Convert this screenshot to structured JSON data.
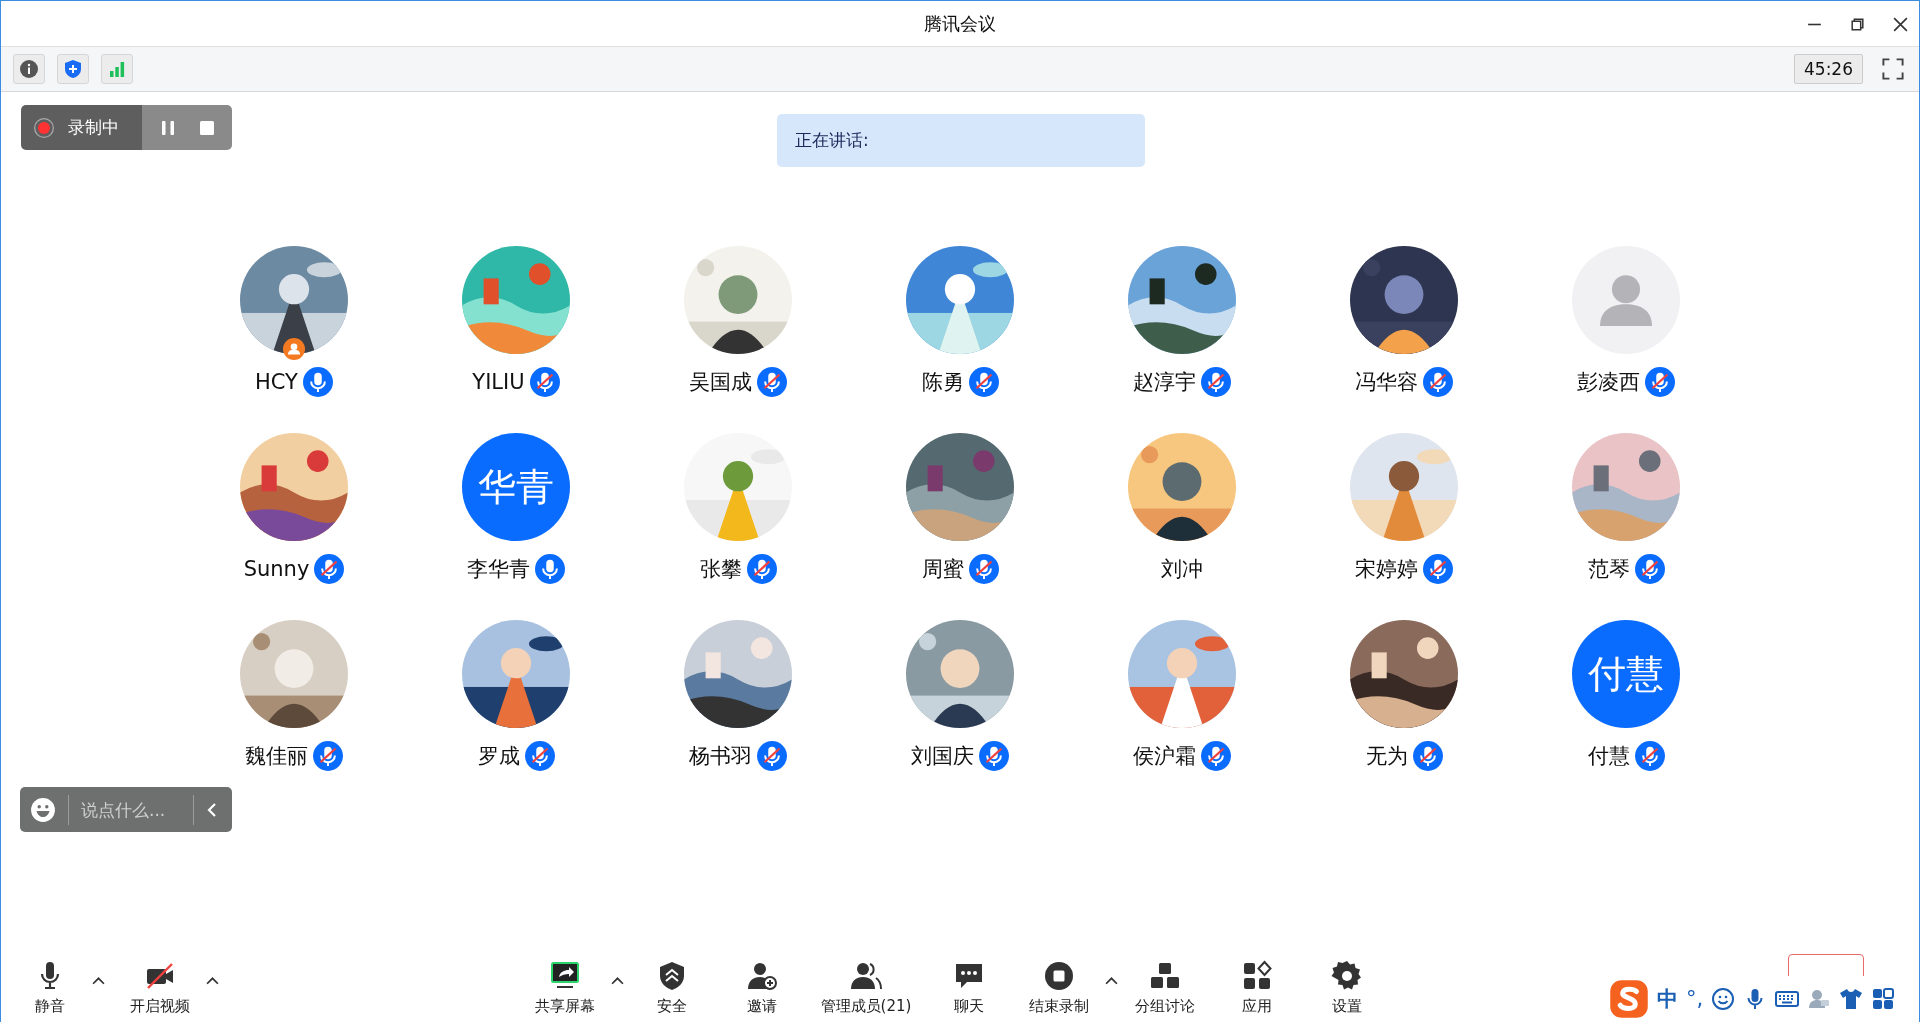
{
  "window": {
    "title": "腾讯会议"
  },
  "top_toolbar": {
    "timer": "45:26"
  },
  "recording": {
    "label": "录制中"
  },
  "speaking": {
    "label": "正在讲话:"
  },
  "participants": [
    {
      "name": "HCY",
      "muted": false,
      "host": true
    },
    {
      "name": "YILIU",
      "muted": true,
      "host": false
    },
    {
      "name": "吴国成",
      "muted": true,
      "host": false
    },
    {
      "name": "陈勇",
      "muted": true,
      "host": false
    },
    {
      "name": "赵淳宇",
      "muted": true,
      "host": false
    },
    {
      "name": "冯华容",
      "muted": true,
      "host": false
    },
    {
      "name": "彭凌西",
      "avatar": {
        "kind": "default"
      },
      "muted": true,
      "host": false
    },
    {
      "name": "Sunny",
      "muted": true,
      "host": false
    },
    {
      "name": "李华青",
      "avatar": {
        "kind": "initials",
        "text": "华青"
      },
      "muted": false,
      "host": false
    },
    {
      "name": "张攀",
      "muted": true,
      "host": false
    },
    {
      "name": "周蜜",
      "muted": true,
      "host": false
    },
    {
      "name": "刘冲",
      "host": false
    },
    {
      "name": "宋婷婷",
      "muted": true,
      "host": false
    },
    {
      "name": "范琴",
      "muted": true,
      "host": false
    },
    {
      "name": "魏佳丽",
      "muted": true,
      "host": false
    },
    {
      "name": "罗成",
      "muted": true,
      "host": false
    },
    {
      "name": "杨书羽",
      "muted": true,
      "host": false
    },
    {
      "name": "刘国庆",
      "muted": true,
      "host": false
    },
    {
      "name": "侯沪霜",
      "muted": true,
      "host": false
    },
    {
      "name": "无为",
      "muted": true,
      "host": false
    },
    {
      "name": "付慧",
      "avatar": {
        "kind": "initials",
        "text": "付慧"
      },
      "muted": true,
      "host": false
    }
  ],
  "chat_input": {
    "placeholder": "说点什么..."
  },
  "toolbar": [
    {
      "label": "静音",
      "kind": "mic",
      "caret": true
    },
    {
      "label": "开启视频",
      "kind": "camera",
      "caret": true
    },
    {
      "label": "共享屏幕",
      "kind": "share",
      "caret": true
    },
    {
      "label": "安全",
      "kind": "shield",
      "caret": false
    },
    {
      "label": "邀请",
      "kind": "invite",
      "caret": false
    },
    {
      "label": "管理成员(21)",
      "kind": "members",
      "caret": false
    },
    {
      "label": "聊天",
      "kind": "chat",
      "caret": false
    },
    {
      "label": "结束录制",
      "kind": "stop",
      "caret": true
    },
    {
      "label": "分组讨论",
      "kind": "groups",
      "caret": false
    },
    {
      "label": "应用",
      "kind": "apps",
      "caret": false
    },
    {
      "label": "设置",
      "kind": "settings",
      "caret": false
    }
  ],
  "ime_bar": {
    "mode": "中",
    "punctuation": "°,"
  }
}
